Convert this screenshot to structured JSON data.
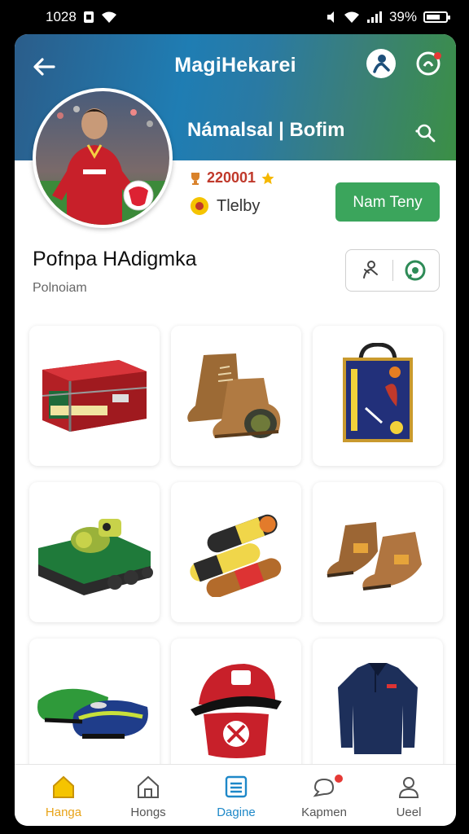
{
  "status_bar": {
    "time": "1028",
    "battery": "39%",
    "icons": [
      "sim-icon",
      "wifi-icon",
      "mute-icon",
      "wifi-icon",
      "signal-icon",
      "battery-icon"
    ]
  },
  "header": {
    "title": "MagiHekarei",
    "icons": [
      "back-arrow-icon",
      "user-icon",
      "notification-icon",
      "search-icon"
    ]
  },
  "profile": {
    "name": "Námalsal | Bofim",
    "stat_points": "220001",
    "stat_label": "Tlelby",
    "follow_label": "Nam Teny"
  },
  "section": {
    "title": "Pofnpa HAdigmka",
    "subtitle": "Polnoiam"
  },
  "action_icons": [
    "share-icon",
    "chat-icon"
  ],
  "products": [
    {
      "name": "equipment-trunk"
    },
    {
      "name": "leather-boots"
    },
    {
      "name": "tote-bag"
    },
    {
      "name": "tank-toy"
    },
    {
      "name": "shin-guard-rolls"
    },
    {
      "name": "ankle-boots"
    },
    {
      "name": "football-cleats"
    },
    {
      "name": "red-cap"
    },
    {
      "name": "navy-jersey"
    }
  ],
  "bottom_nav": [
    {
      "label": "Hanga",
      "icon": "home-icon",
      "active": true
    },
    {
      "label": "Hongs",
      "icon": "house-outline-icon",
      "active": false
    },
    {
      "label": "Dagine",
      "icon": "list-icon",
      "active": false
    },
    {
      "label": "Kapmen",
      "icon": "chat-bubble-icon",
      "active": false
    },
    {
      "label": "Ueel",
      "icon": "profile-icon",
      "active": false
    }
  ],
  "colors": {
    "follow_button": "#3ba55c",
    "active_nav": "#e8a317",
    "accent_blue": "#1e88c8",
    "header_gradient_start": "#2b5d8a",
    "header_gradient_end": "#3b8f45"
  }
}
